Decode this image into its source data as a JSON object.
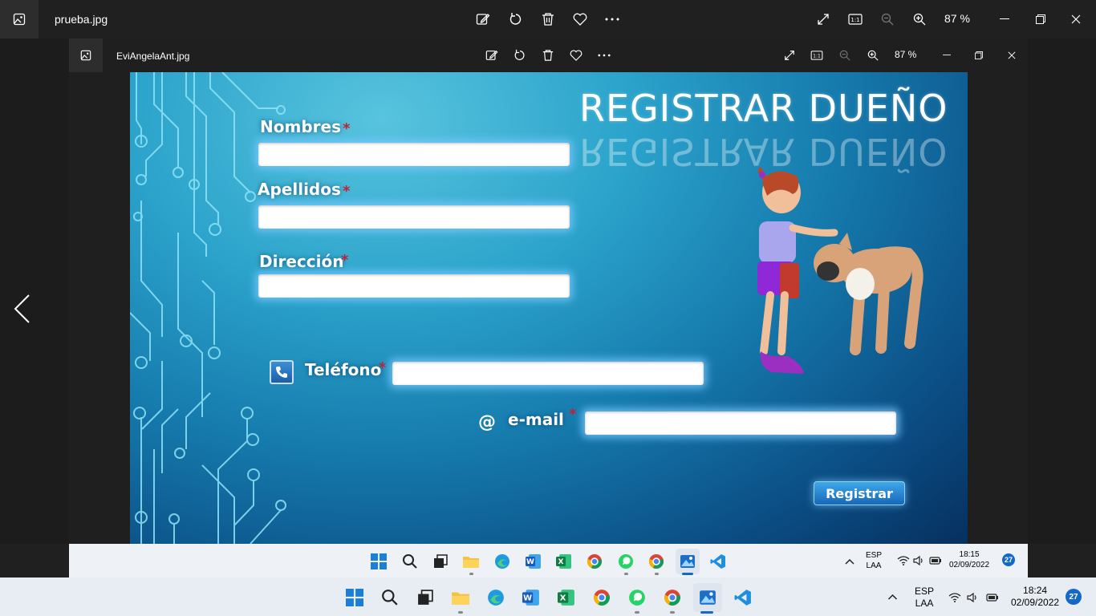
{
  "outer_window": {
    "title": "prueba.jpg",
    "zoom": "87 %",
    "icons": [
      "photo-icon",
      "edit-icon",
      "rotate-icon",
      "delete-icon",
      "favorite-icon",
      "more-icon",
      "fullscreen-icon",
      "actual-size-icon",
      "zoom-out-icon",
      "zoom-in-icon",
      "minimize-icon",
      "maximize-icon",
      "close-icon"
    ]
  },
  "inner_window": {
    "title": "EviAngelaAnt.jpg",
    "zoom": "87 %"
  },
  "photo": {
    "heading": "REGISTRAR DUEÑO",
    "heading_reflection": "REGISTRAR DUEÑO",
    "fields": {
      "nombres": "Nombres",
      "apellidos": "Apellidos",
      "direccion": "Dirección",
      "telefono": "Teléfono",
      "email": "e-mail"
    },
    "required_mark": "*",
    "at_symbol": "@",
    "register_button": "Registrar"
  },
  "taskbar_inner": {
    "lang": "ESP",
    "layout": "LAA",
    "time": "18:15",
    "date": "02/09/2022",
    "notifications": "27"
  },
  "taskbar_outer": {
    "lang": "ESP",
    "layout": "LAA",
    "time": "18:24",
    "date": "02/09/2022",
    "notifications": "27"
  },
  "taskbar_apps": [
    "start",
    "search",
    "task-view",
    "file-explorer",
    "edge",
    "word",
    "excel",
    "chrome",
    "whatsapp",
    "chrome-profile",
    "photos",
    "vscode"
  ],
  "colors": {
    "accent": "#1469c8",
    "required": "#c0203a",
    "window_bg": "#202020"
  }
}
